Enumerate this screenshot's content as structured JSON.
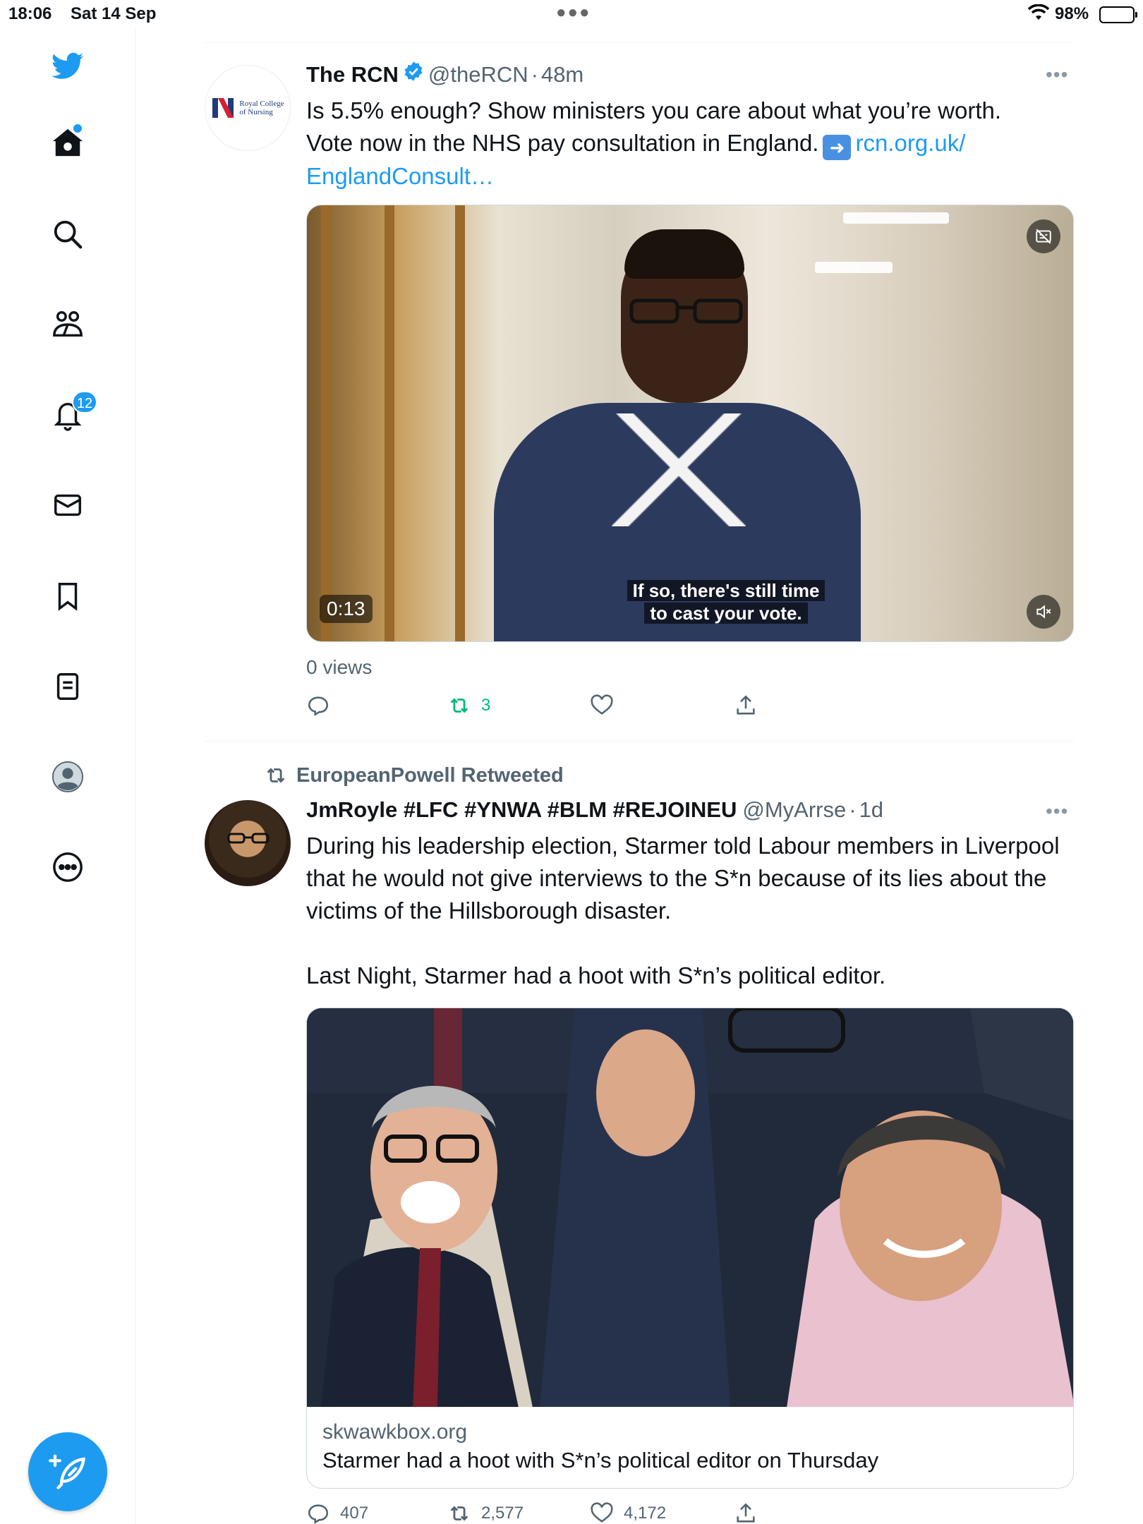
{
  "status_bar": {
    "time": "18:06",
    "date": "Sat 14 Sep",
    "battery": "98%"
  },
  "sidebar": {
    "notifications_count": "12",
    "items": [
      "twitter-logo",
      "home-icon",
      "search-icon",
      "communities-icon",
      "notifications-icon",
      "messages-icon",
      "bookmarks-icon",
      "lists-icon",
      "profile-icon",
      "more-icon"
    ]
  },
  "tweets": [
    {
      "display_name": "The RCN",
      "handle": "@theRCN",
      "time": "48m",
      "verified": true,
      "text_line1": "Is 5.5% enough? Show ministers you care about what you’re worth.",
      "text_line2": "Vote now in the NHS pay consultation in England.",
      "link_part1": "rcn.org.uk/",
      "link_part2": "EnglandConsult…",
      "avatar_text1": "Royal College",
      "avatar_text2": "of Nursing",
      "video_time": "0:13",
      "caption_line1": "If so, there's still time",
      "caption_line2": "to cast your vote.",
      "views": "0 views",
      "replies": "",
      "retweets": "3",
      "likes": ""
    },
    {
      "retweeted_by": "EuropeanPowell Retweeted",
      "display_name": "JmRoyle #LFC #YNWA #BLM #REJOINEU",
      "handle": "@MyArrse",
      "time": "1d",
      "text_p1": "During his leadership election, Starmer told Labour members in Liverpool that he would not give interviews to the S*n because of its lies about the victims of the Hillsborough disaster.",
      "text_p2": "Last Night, Starmer had a hoot with S*n’s political editor.",
      "card_domain": "skwawkbox.org",
      "card_title": "Starmer had a hoot with S*n’s political editor on Thursday",
      "replies": "407",
      "retweets": "2,577",
      "likes": "4,172"
    }
  ],
  "colors": {
    "accent": "#1d9bf0",
    "retweet_green": "#00ba7c",
    "muted": "#536471"
  }
}
